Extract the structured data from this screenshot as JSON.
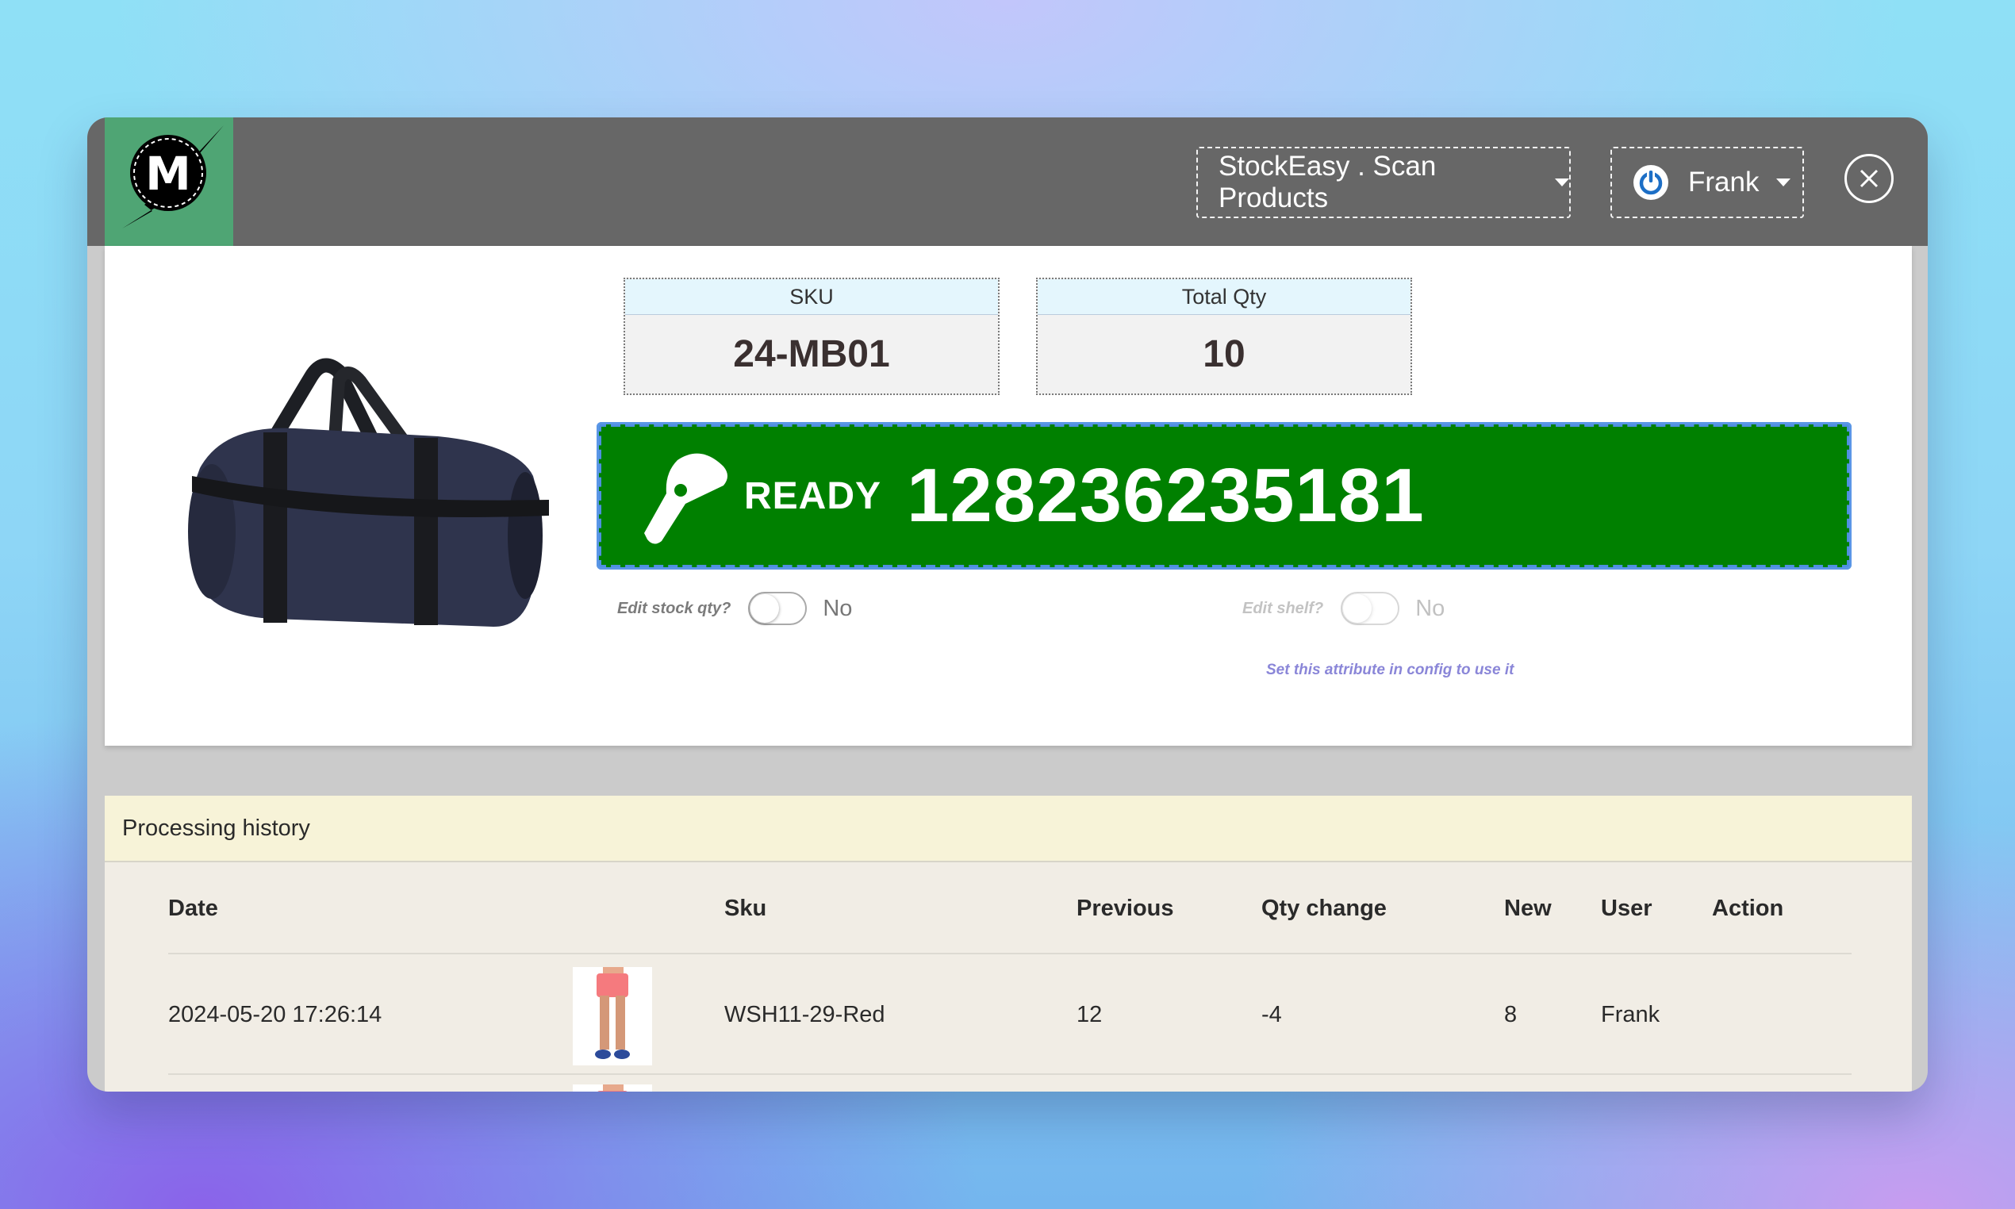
{
  "header": {
    "app_menu_label": "StockEasy . Scan Products",
    "user_label": "Frank"
  },
  "product": {
    "sku_header": "SKU",
    "sku_value": "24-MB01",
    "qty_header": "Total Qty",
    "qty_value": "10"
  },
  "scanner": {
    "status": "READY",
    "barcode": "128236235181",
    "color": "#008000"
  },
  "toggles": {
    "stock_label": "Edit stock qty?",
    "stock_value": "No",
    "shelf_label": "Edit shelf?",
    "shelf_value": "No",
    "shelf_note": "Set this attribute in config to use it"
  },
  "history": {
    "title": "Processing history",
    "columns": {
      "date": "Date",
      "sku": "Sku",
      "previous": "Previous",
      "qty_change": "Qty change",
      "new": "New",
      "user": "User",
      "action": "Action"
    },
    "rows": [
      {
        "date": "2024-05-20 17:26:14",
        "sku": "WSH11-29-Red",
        "previous": "12",
        "qty_change": "-4",
        "new": "8",
        "user": "Frank",
        "action": ""
      }
    ]
  }
}
